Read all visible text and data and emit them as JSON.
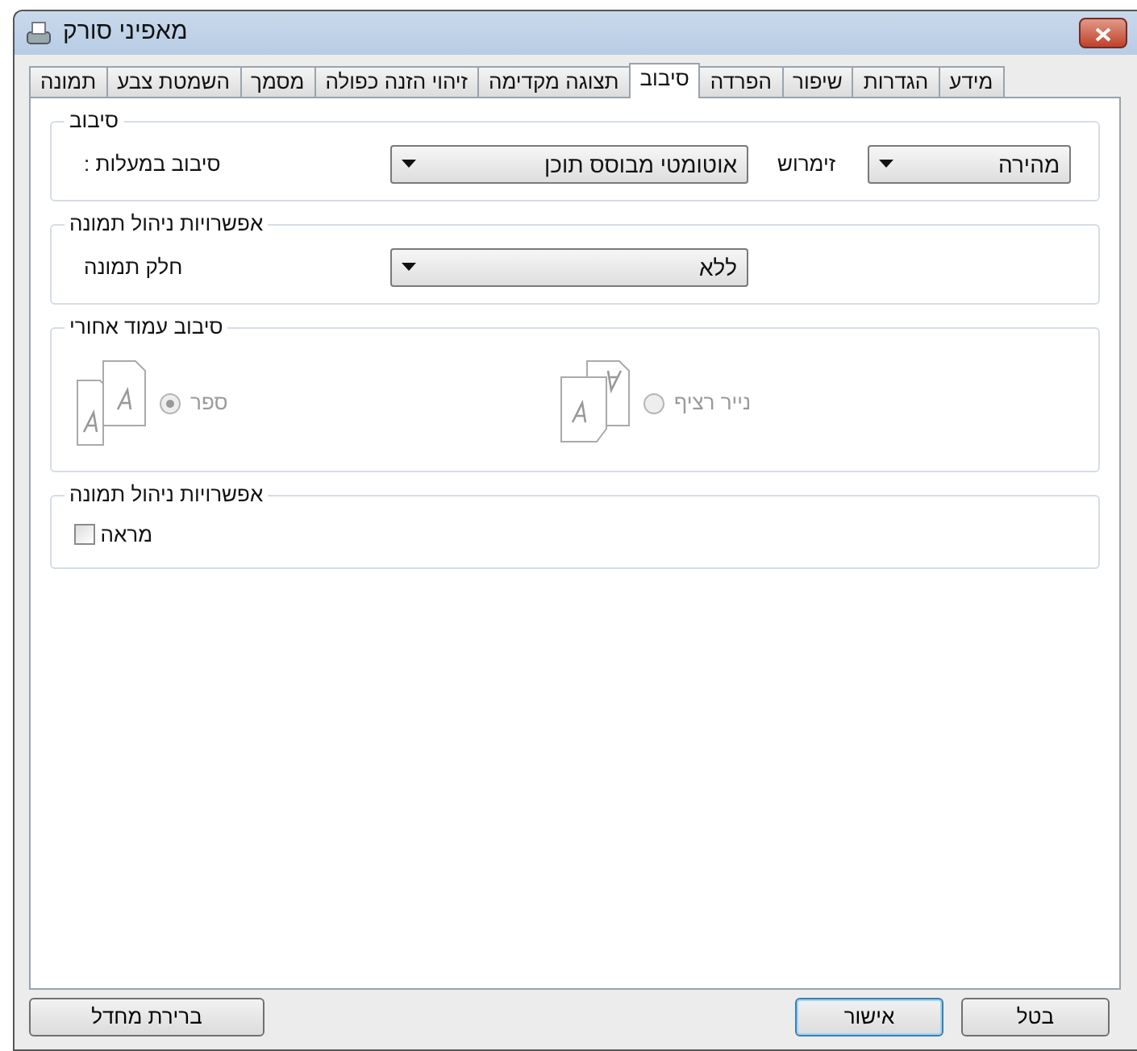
{
  "window": {
    "title": "מאפיני סורק"
  },
  "tabs": [
    {
      "label": "מידע",
      "selected": false
    },
    {
      "label": "הגדרות",
      "selected": false
    },
    {
      "label": "שיפור",
      "selected": false
    },
    {
      "label": "הפרדה",
      "selected": false
    },
    {
      "label": "סיבוב",
      "selected": true
    },
    {
      "label": "תצוגה מקדימה",
      "selected": false
    },
    {
      "label": "זיהוי הזנה כפולה",
      "selected": false
    },
    {
      "label": "מסמך",
      "selected": false
    },
    {
      "label": "השמטת צבע",
      "selected": false
    },
    {
      "label": "תמונה",
      "selected": false
    }
  ],
  "groups": [
    {
      "title": "סיבוב",
      "rows": [
        {
          "kind": "dropdowns",
          "label": "סיבוב במעלות :",
          "value": "אוטומטי מבוסס תוכן",
          "label_2": "זימרוש",
          "value_2": "מהירה"
        }
      ]
    },
    {
      "title": "אפשרויות ניהול תמונה",
      "rows": [
        {
          "kind": "dropdown",
          "label": "חלק תמונה",
          "value": "ללא"
        }
      ]
    },
    {
      "title": "סיבוב עמוד אחורי",
      "rows": [
        {
          "kind": "radios",
          "options": [
            {
              "kind": "fanfold",
              "label": "נייר רציף",
              "selected": false,
              "disabled": true
            },
            {
              "kind": "book",
              "label": "ספר",
              "selected": true,
              "disabled": true
            }
          ]
        }
      ]
    },
    {
      "title": "אפשרויות ניהול תמונה",
      "rows": [
        {
          "kind": "checkbox",
          "label": "מראה",
          "checked": false
        }
      ]
    }
  ],
  "buttons": {
    "default": "ברירת מחדל",
    "ok": "אישור",
    "cancel": "בטל"
  }
}
